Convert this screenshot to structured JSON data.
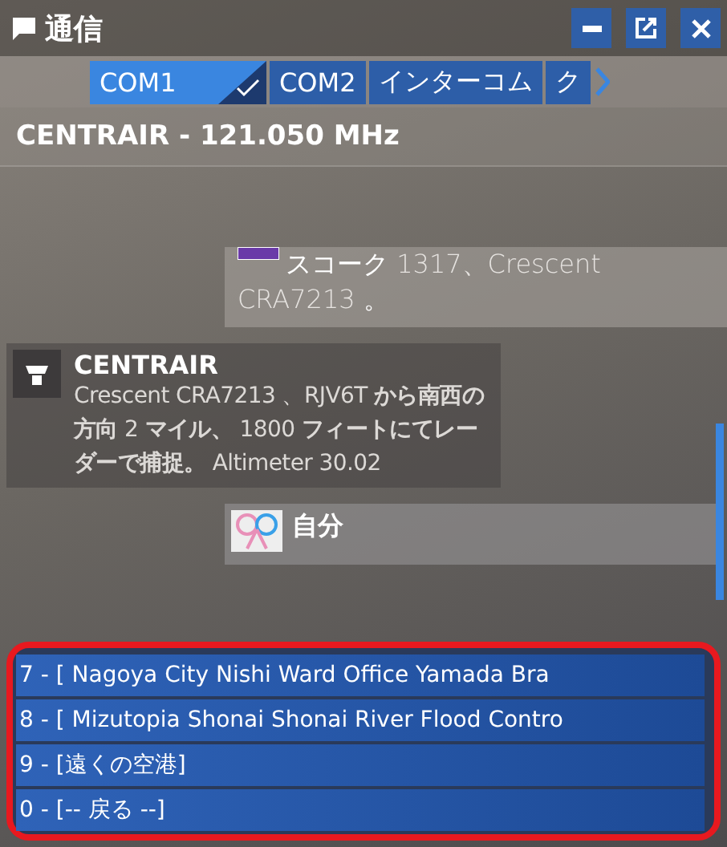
{
  "window": {
    "title": "通信",
    "buttons": [
      {
        "kind": "minimize"
      },
      {
        "kind": "popout"
      },
      {
        "kind": "close"
      }
    ]
  },
  "tabs": [
    {
      "label": "COM1",
      "selected": true
    },
    {
      "label": "COM2",
      "selected": false
    },
    {
      "label": "インターコム",
      "selected": false
    },
    {
      "label": "ク",
      "selected": false
    }
  ],
  "frequency": "CENTRAIR - 121.050 MHz",
  "messages": [
    {
      "kind": "user",
      "lines": [
        "**スコーク** 1317、Crescent",
        "CRA7213 **。**"
      ]
    },
    {
      "kind": "atc",
      "sender": "CENTRAIR",
      "text": "Crescent CRA7213 、RJV6T **から南西の方向** 2 **マイル、** 1800 **フィートにてレーダーで捕捉。** Altimeter 30.02"
    },
    {
      "kind": "self",
      "sender": "自分"
    }
  ],
  "options": [
    {
      "label": "7 - [ Nagoya City Nishi Ward Office Yamada Bra"
    },
    {
      "label": "8 - [ Mizutopia Shonai Shonai River Flood Contro"
    },
    {
      "label": "9 - [遠くの空港]"
    },
    {
      "label": "0 - [-- 戻る --]"
    }
  ]
}
